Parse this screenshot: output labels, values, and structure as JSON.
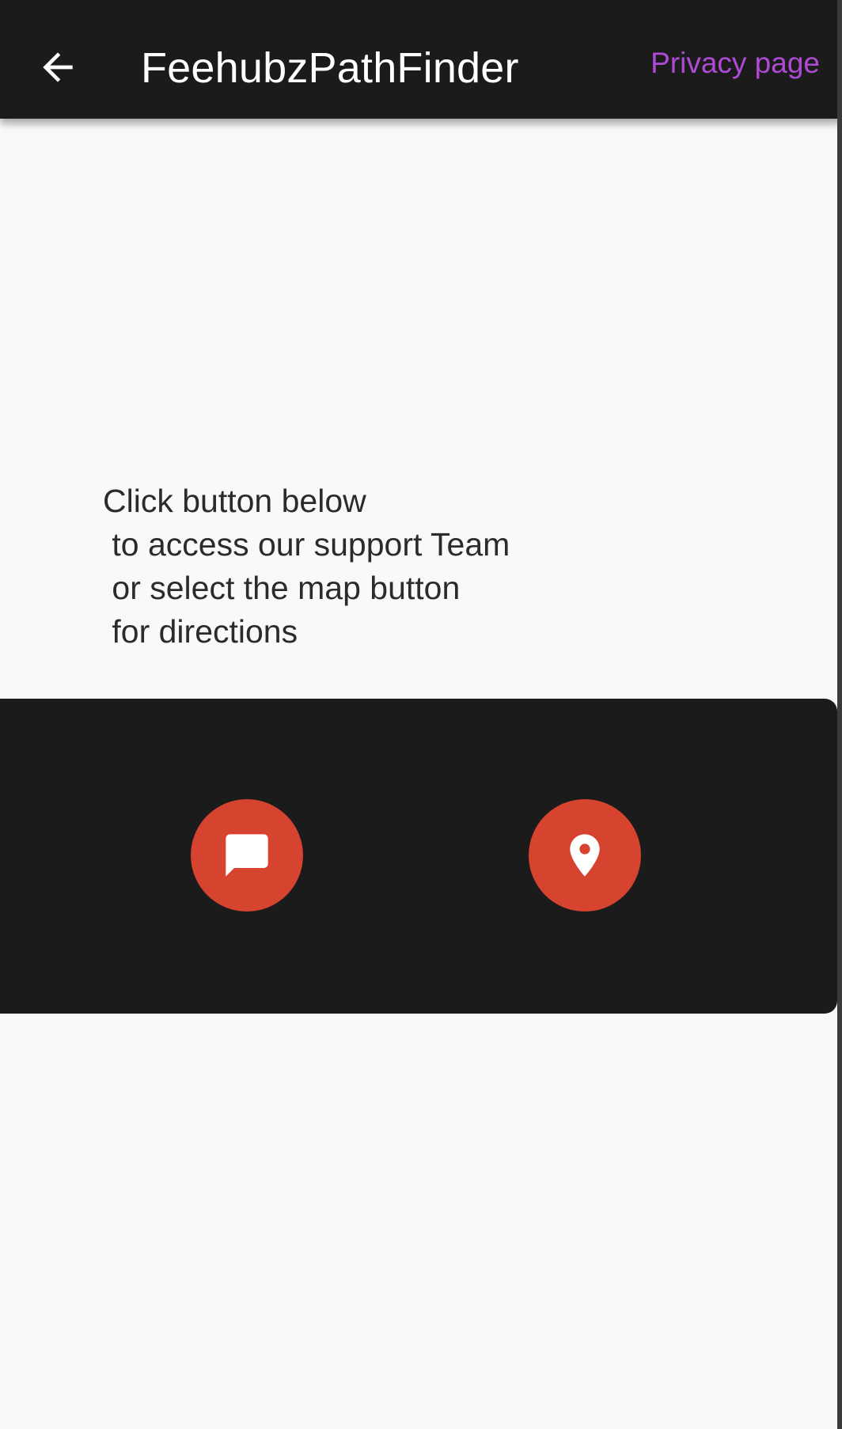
{
  "app_bar": {
    "title": "FeehubzPathFinder",
    "privacy_link": "Privacy page",
    "back_icon": "arrow-left-icon"
  },
  "main": {
    "instructions": "Click button below\n to access our support Team\n or select the map button\n for directions"
  },
  "actions": {
    "support_icon": "chat-bubble-icon",
    "map_icon": "map-pin-icon"
  },
  "colors": {
    "app_bar_bg": "#1b1b1b",
    "panel_bg": "#1b1b1b",
    "accent_link": "#b04ad6",
    "fab_red": "#d64430",
    "page_bg": "#f9f9f9"
  }
}
